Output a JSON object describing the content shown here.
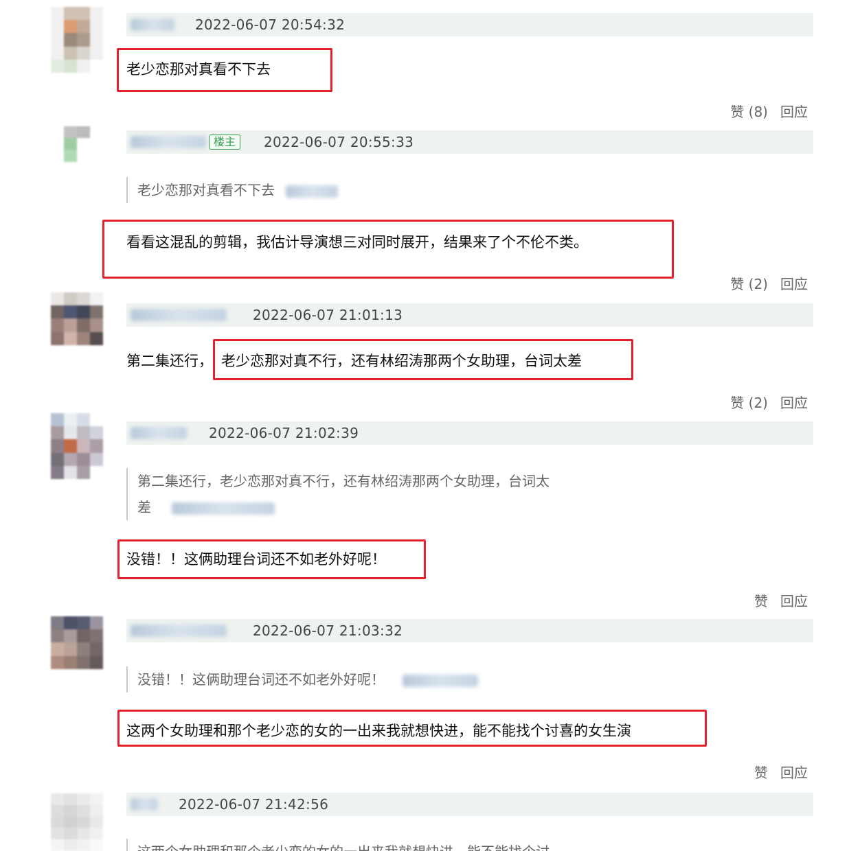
{
  "owner_badge": "楼主",
  "like_label": "赞",
  "reply_label": "回应",
  "comments": [
    {
      "timestamp": "2022-06-07 20:54:32",
      "body": "老少恋那对真看不下去",
      "likes": "(8)"
    },
    {
      "timestamp": "2022-06-07 20:55:33",
      "quote": "老少恋那对真看不下去",
      "body": "看看这混乱的剪辑，我估计导演想三对同时展开，结果来了个不伦不类。",
      "likes": "(2)"
    },
    {
      "timestamp": "2022-06-07 21:01:13",
      "body_prefix": "第二集还行，",
      "body": "老少恋那对真不行，还有林绍涛那两个女助理，台词太差",
      "likes": "(2)"
    },
    {
      "timestamp": "2022-06-07 21:02:39",
      "quote_line1": "第二集还行，老少恋那对真不行，还有林绍涛那两个女助理，台词太",
      "quote_line2": "差",
      "body": "没错！！这俩助理台词还不如老外好呢！",
      "likes": ""
    },
    {
      "timestamp": "2022-06-07 21:03:32",
      "quote": "没错！！这俩助理台词还不如老外好呢！",
      "body": "这两个女助理和那个老少恋的女的一出来我就想快进，能不能找个讨喜的女生演",
      "likes": ""
    },
    {
      "timestamp": "2022-06-07 21:42:56",
      "quote": "这两个女助理和那个老少恋的女的一出来我就想快进，能不能找个讨"
    }
  ]
}
